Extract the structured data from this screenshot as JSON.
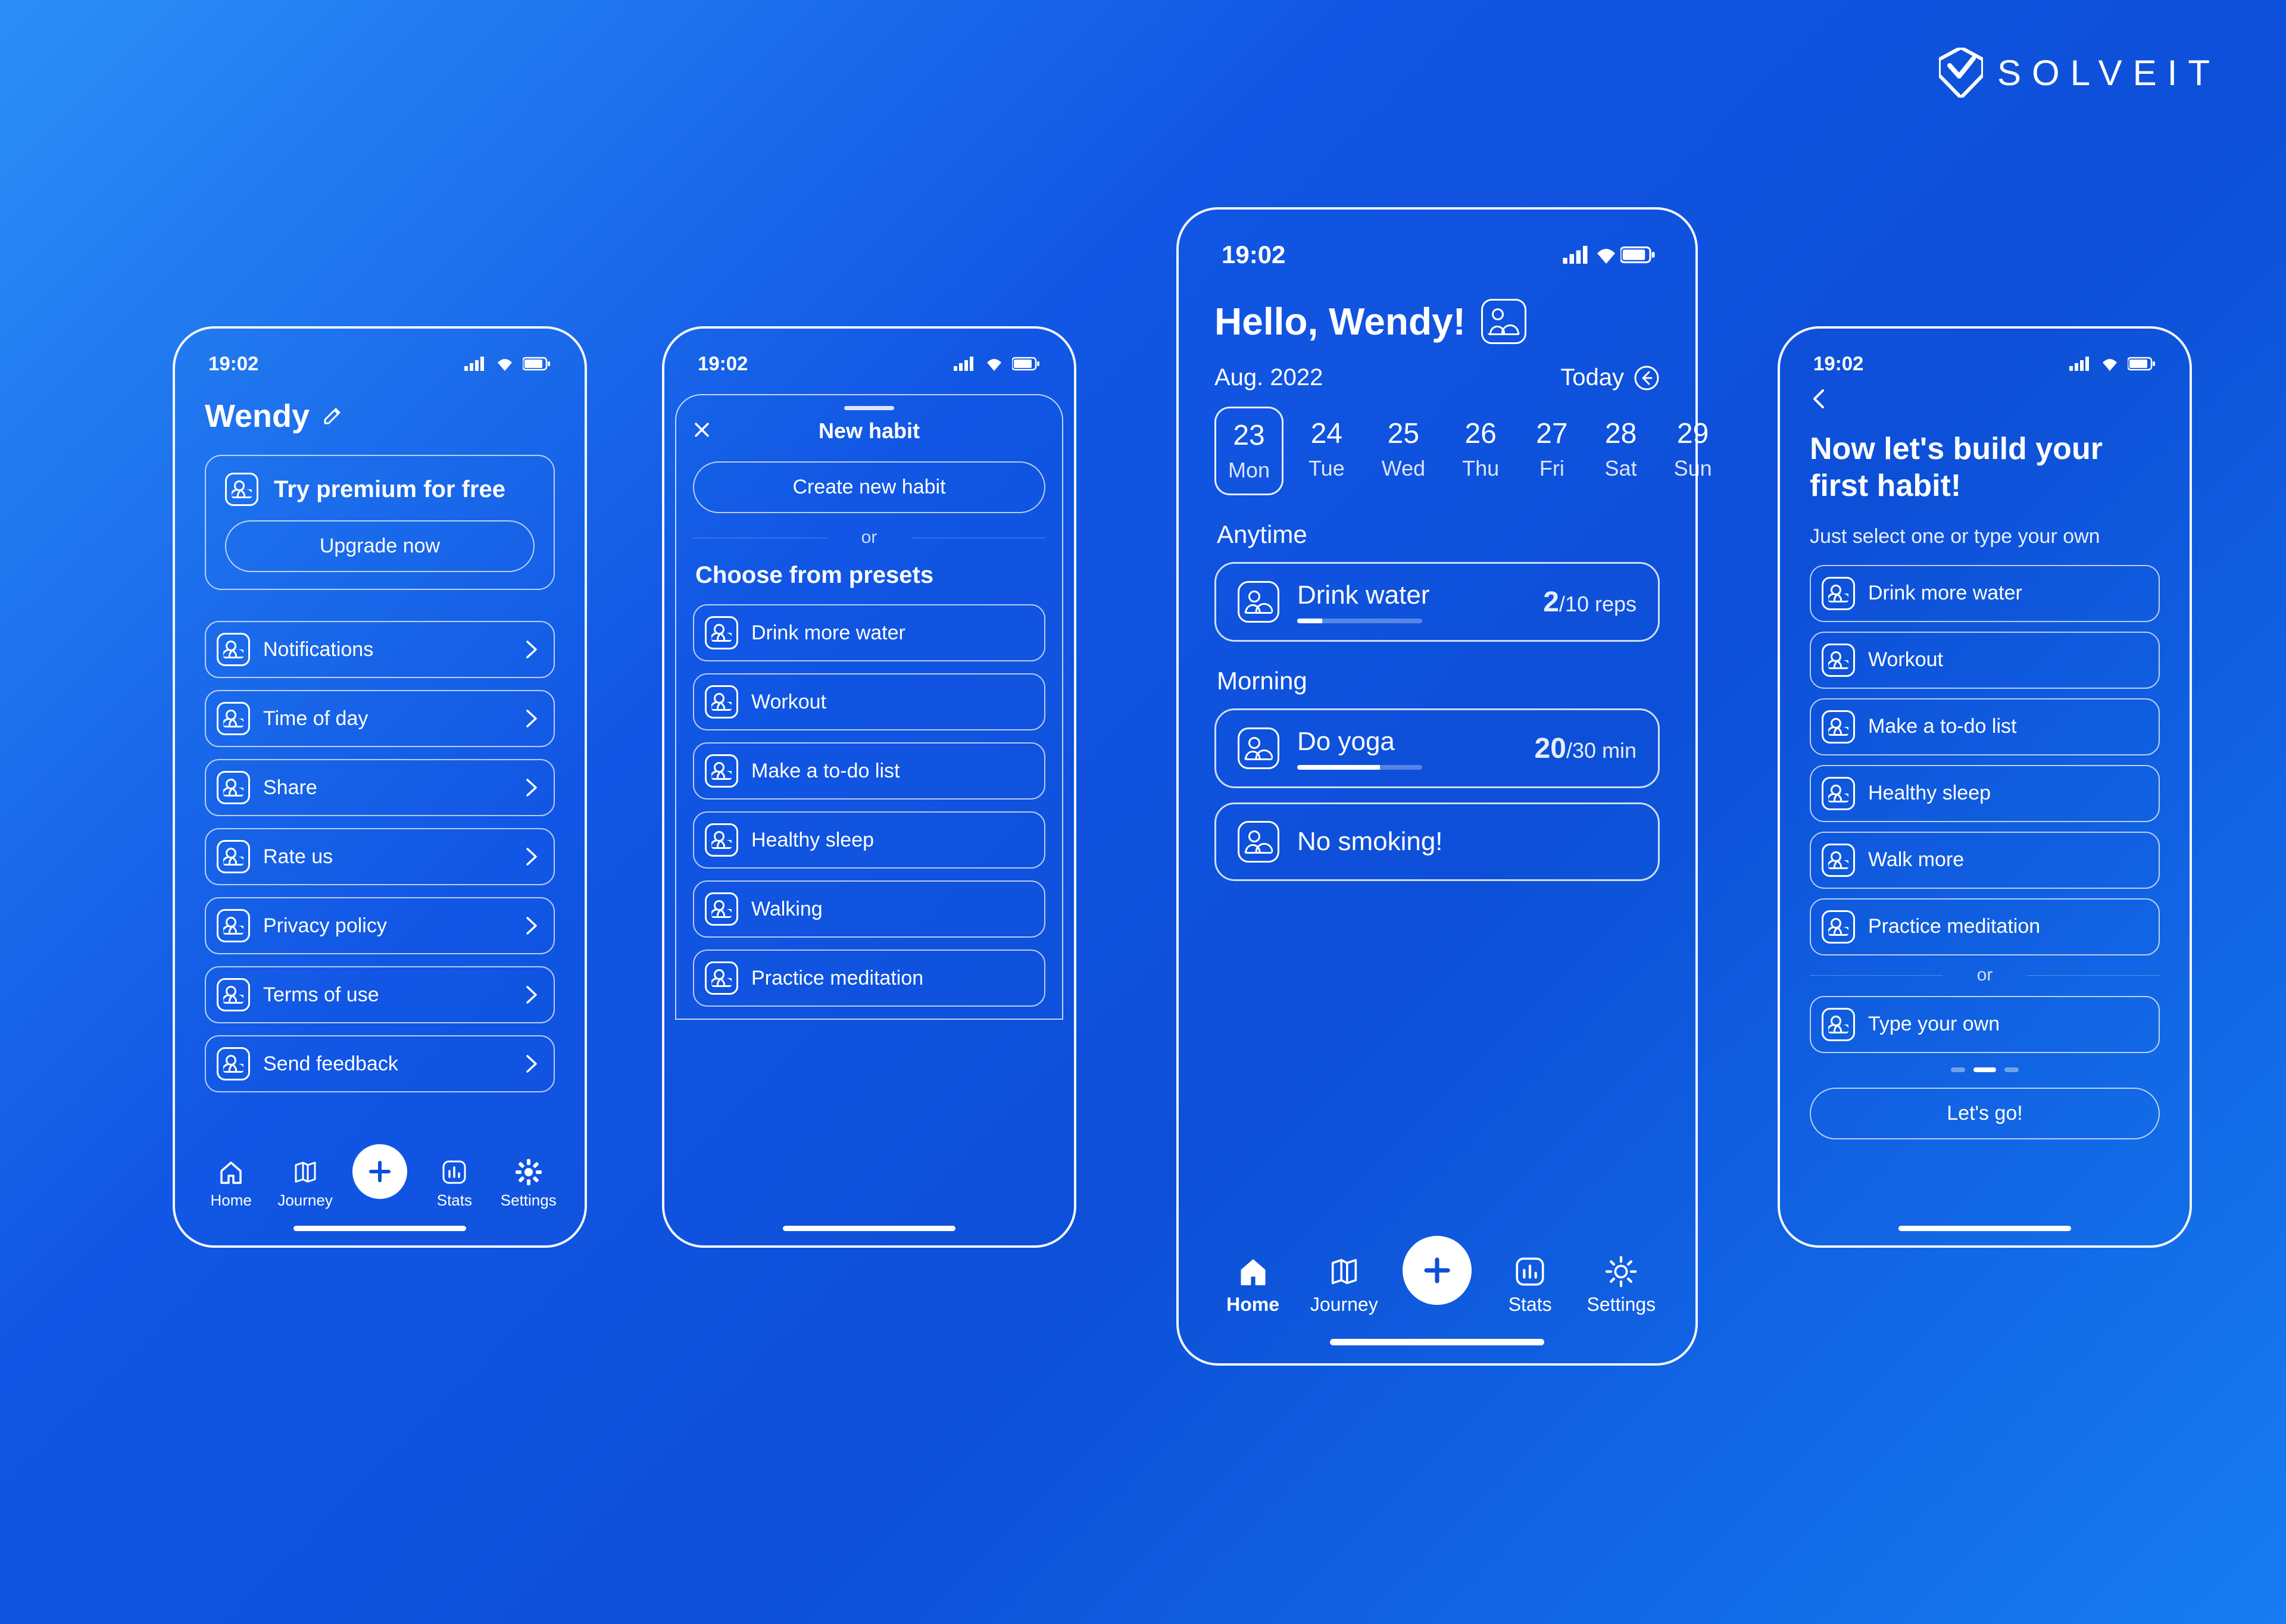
{
  "brand": "SOLVEIT",
  "status": {
    "time": "19:02"
  },
  "screen1": {
    "user": "Wendy",
    "premium_title": "Try premium for free",
    "upgrade_btn": "Upgrade now",
    "menu": [
      "Notifications",
      "Time of day",
      "Share",
      "Rate us",
      "Privacy policy",
      "Terms of use",
      "Send feedback"
    ]
  },
  "screen2": {
    "drawer_title": "New habit",
    "create_btn": "Create new habit",
    "or": "or",
    "choose_title": "Choose from presets",
    "presets": [
      "Drink more water",
      "Workout",
      "Make a to-do list",
      "Healthy sleep",
      "Walking",
      "Practice meditation"
    ]
  },
  "screen3": {
    "greeting": "Hello, Wendy!",
    "month": "Aug. 2022",
    "today": "Today",
    "days": [
      {
        "num": "23",
        "dow": "Mon",
        "sel": true
      },
      {
        "num": "24",
        "dow": "Tue"
      },
      {
        "num": "25",
        "dow": "Wed"
      },
      {
        "num": "26",
        "dow": "Thu"
      },
      {
        "num": "27",
        "dow": "Fri"
      },
      {
        "num": "28",
        "dow": "Sat"
      },
      {
        "num": "29",
        "dow": "Sun"
      }
    ],
    "groups": [
      {
        "label": "Anytime",
        "habits": [
          {
            "name": "Drink water",
            "done": "2",
            "total": "/10 reps",
            "pct": 20
          }
        ]
      },
      {
        "label": "Morning",
        "habits": [
          {
            "name": "Do yoga",
            "done": "20",
            "total": "/30 min",
            "pct": 66
          },
          {
            "name": "No smoking!"
          }
        ]
      }
    ]
  },
  "screen4": {
    "title_l1": "Now let's build your",
    "title_l2": "first habit!",
    "sub": "Just select one or type your own",
    "options": [
      "Drink more water",
      "Workout",
      "Make a to-do list",
      "Healthy sleep",
      "Walk more",
      "Practice meditation"
    ],
    "or": "or",
    "type_own": "Type your own",
    "go": "Let's go!"
  },
  "nav": {
    "home": "Home",
    "journey": "Journey",
    "stats": "Stats",
    "settings": "Settings"
  }
}
